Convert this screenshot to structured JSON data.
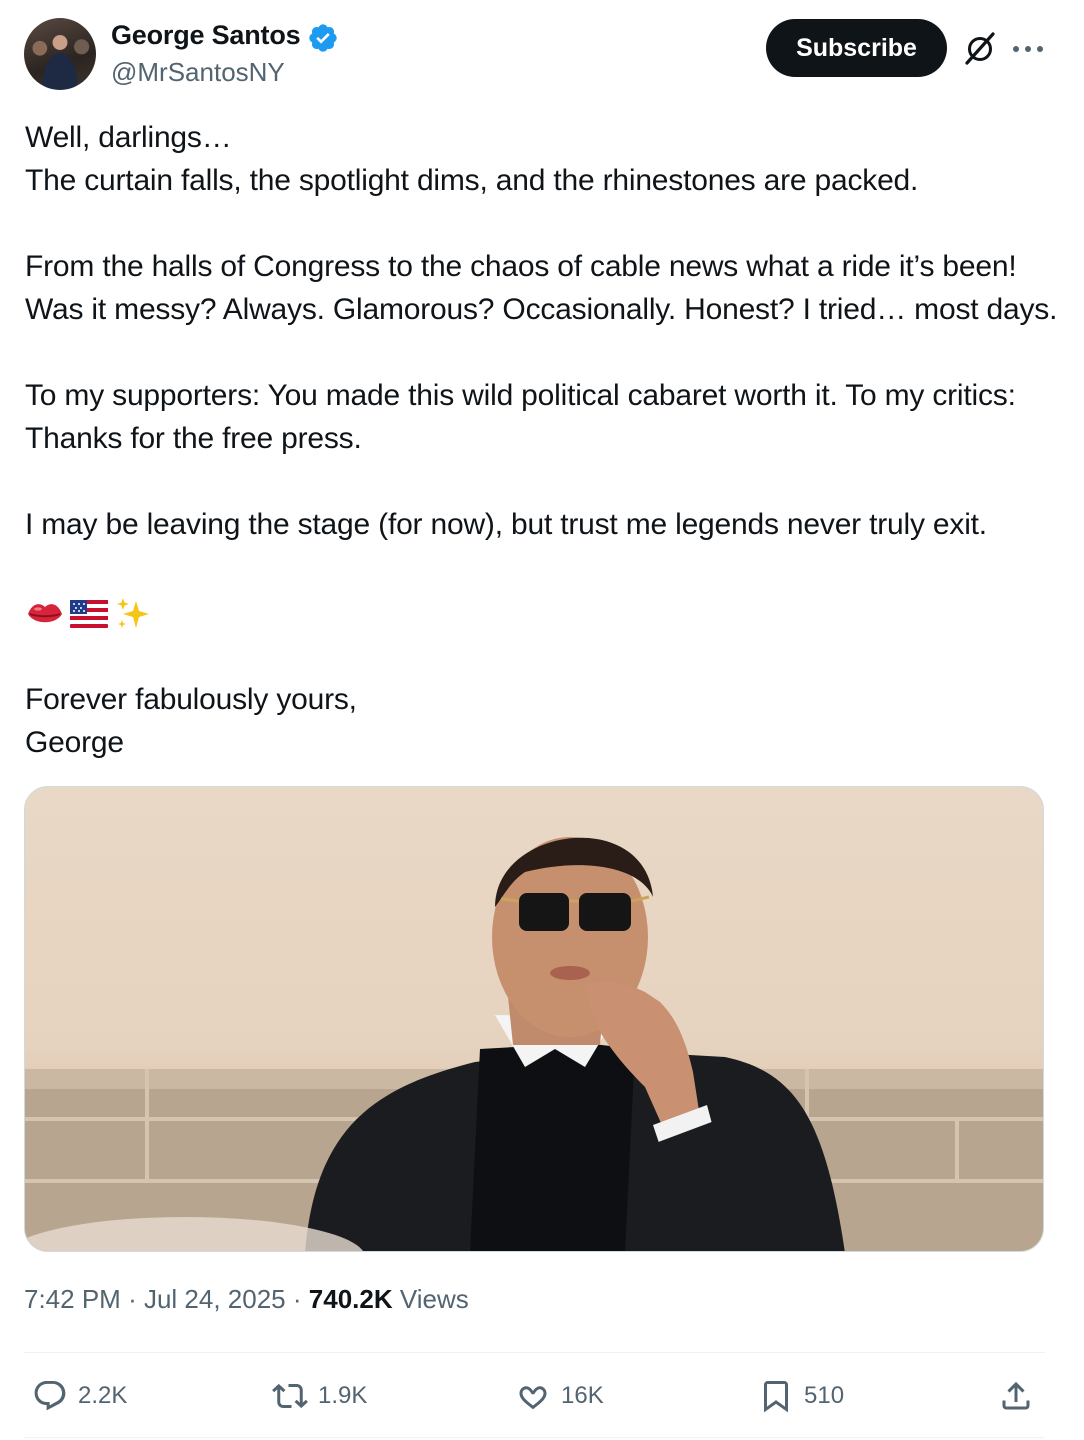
{
  "author": {
    "name": "George Santos",
    "handle": "@MrSantosNY"
  },
  "header": {
    "subscribe_label": "Subscribe"
  },
  "post": {
    "text": "Well, darlings…\nThe curtain falls, the spotlight dims, and the rhinestones are packed.\n\nFrom the halls of Congress to the chaos of cable news what a ride it’s been! Was it messy? Always. Glamorous? Occasionally. Honest? I tried… most days.\n\nTo my supporters: You made this wild political cabaret worth it. To my critics: Thanks for the free press.\n\nI may be leaving the stage (for now), but trust me legends never truly exit.",
    "emojis": [
      "💋",
      "🇺🇸",
      "✨"
    ],
    "signoff": "Forever fabulously yours,\nGeorge"
  },
  "meta": {
    "time": "7:42 PM",
    "sep1": "·",
    "date": "Jul 24, 2025",
    "sep2": "·",
    "views_count": "740.2K",
    "views_label": "Views"
  },
  "actions": {
    "replies": "2.2K",
    "reposts": "1.9K",
    "likes": "16K",
    "bookmarks": "510"
  },
  "colors": {
    "verified": "#1d9bf0",
    "text_secondary": "#536471",
    "button_bg": "#0f1419"
  }
}
